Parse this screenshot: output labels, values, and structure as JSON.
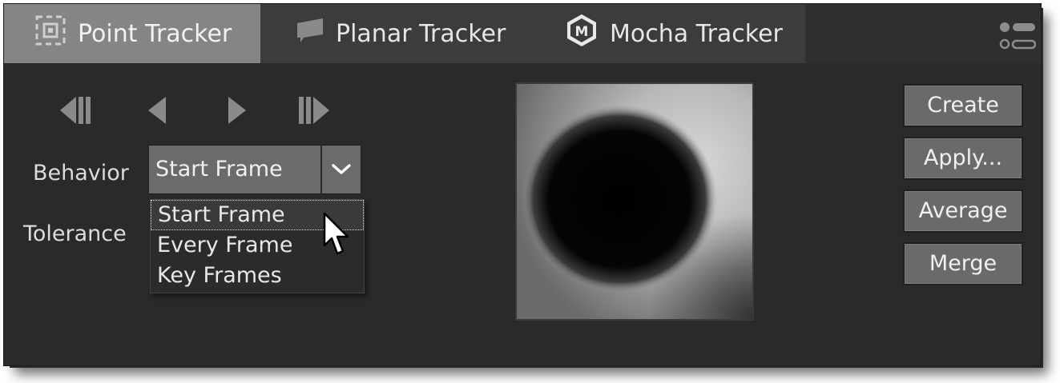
{
  "tabs": [
    {
      "label": "Point Tracker",
      "icon": "point-tracker-icon",
      "active": true
    },
    {
      "label": "Planar Tracker",
      "icon": "planar-tracker-icon",
      "active": false
    },
    {
      "label": "Mocha Tracker",
      "icon": "mocha-icon",
      "active": false
    }
  ],
  "mocha_badge": "M",
  "transport": [
    {
      "icon": "step-back-icon"
    },
    {
      "icon": "track-back-icon"
    },
    {
      "icon": "track-forward-icon"
    },
    {
      "icon": "step-forward-icon"
    }
  ],
  "behavior": {
    "label": "Behavior",
    "value": "Start Frame",
    "options": [
      "Start Frame",
      "Every Frame",
      "Key Frames"
    ]
  },
  "tolerance": {
    "label": "Tolerance"
  },
  "buttons": {
    "create": "Create",
    "apply": "Apply...",
    "average": "Average",
    "merge": "Merge"
  },
  "colors": {
    "panel_bg": "#2a2a2a",
    "tab_active": "#858585",
    "button_bg": "#6a6a6a",
    "text": "#e6e6e6"
  }
}
